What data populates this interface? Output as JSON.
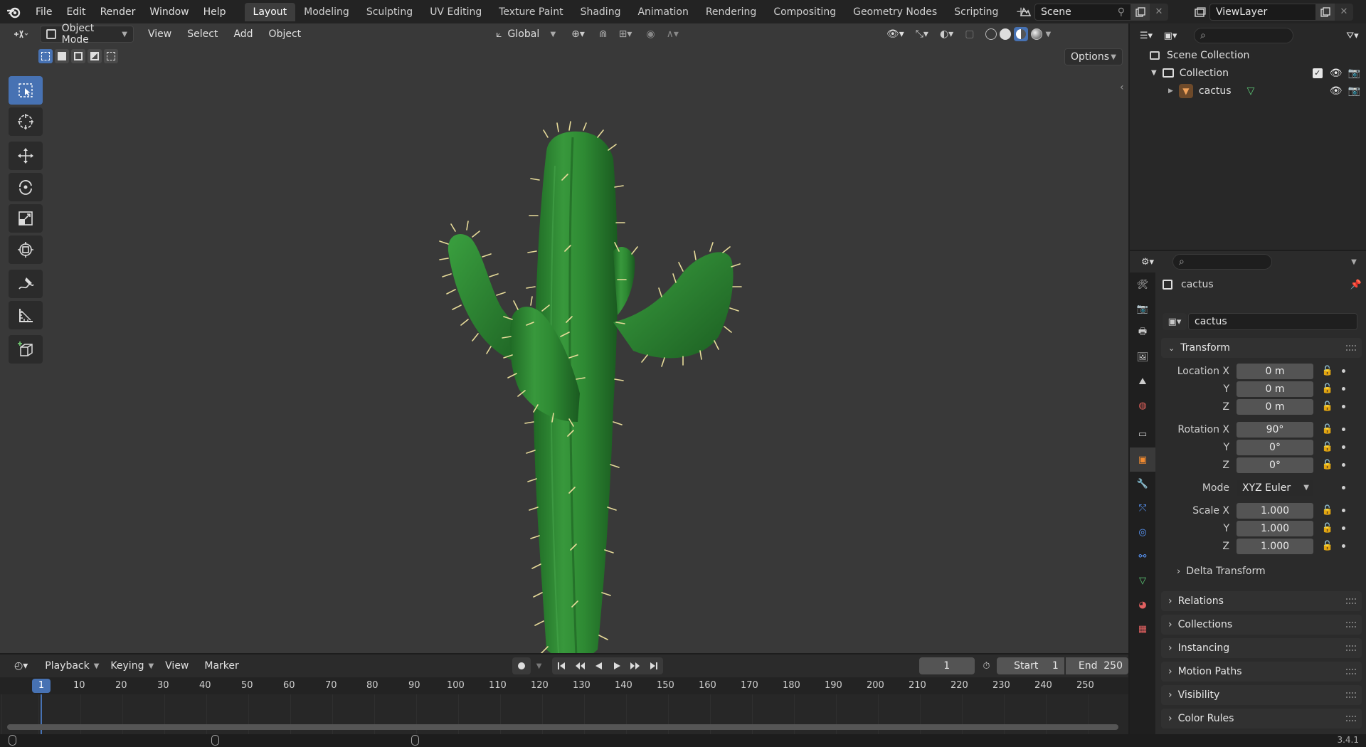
{
  "menu": {
    "items": [
      "File",
      "Edit",
      "Render",
      "Window",
      "Help"
    ]
  },
  "workspaces": {
    "tabs": [
      "Layout",
      "Modeling",
      "Sculpting",
      "UV Editing",
      "Texture Paint",
      "Shading",
      "Animation",
      "Rendering",
      "Compositing",
      "Geometry Nodes",
      "Scripting"
    ],
    "active": "Layout",
    "add": "+"
  },
  "scene": {
    "name": "Scene"
  },
  "viewlayer": {
    "name": "ViewLayer"
  },
  "viewport": {
    "mode": "Object Mode",
    "menus": [
      "View",
      "Select",
      "Add",
      "Object"
    ],
    "orientation": "Global",
    "options": "Options",
    "object_colors": {
      "body": "#2f8a35",
      "spines": "#e8dc9a",
      "background": "#393939"
    }
  },
  "outliner": {
    "scene_collection": "Scene Collection",
    "collection": "Collection",
    "object": "cactus"
  },
  "properties": {
    "object_name": "cactus",
    "datablock_name": "cactus",
    "transform_title": "Transform",
    "location": {
      "label": "Location X",
      "y_label": "Y",
      "z_label": "Z",
      "x": "0 m",
      "y": "0 m",
      "z": "0 m"
    },
    "rotation": {
      "label": "Rotation X",
      "y_label": "Y",
      "z_label": "Z",
      "x": "90°",
      "y": "0°",
      "z": "0°"
    },
    "mode": {
      "label": "Mode",
      "value": "XYZ Euler"
    },
    "scale": {
      "label": "Scale X",
      "y_label": "Y",
      "z_label": "Z",
      "x": "1.000",
      "y": "1.000",
      "z": "1.000"
    },
    "delta": "Delta Transform",
    "sections": [
      "Relations",
      "Collections",
      "Instancing",
      "Motion Paths",
      "Visibility",
      "Color Rules"
    ]
  },
  "timeline": {
    "menus": [
      "Playback",
      "Keying",
      "View",
      "Marker"
    ],
    "current_frame": "1",
    "start_label": "Start",
    "start": "1",
    "end_label": "End",
    "end": "250",
    "ruler": [
      "1",
      "10",
      "20",
      "30",
      "40",
      "50",
      "60",
      "70",
      "80",
      "90",
      "100",
      "110",
      "120",
      "130",
      "140",
      "150",
      "160",
      "170",
      "180",
      "190",
      "200",
      "210",
      "220",
      "230",
      "240",
      "250"
    ]
  },
  "status": {
    "version": "3.4.1"
  }
}
